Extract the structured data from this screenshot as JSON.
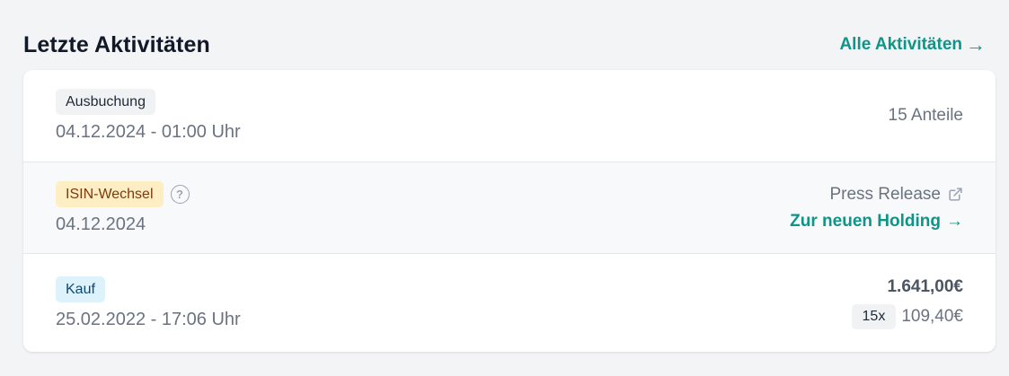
{
  "header": {
    "title": "Letzte Aktivitäten",
    "all_link_label": "Alle Aktivitäten",
    "all_link_arrow": "→"
  },
  "activities": [
    {
      "badge": "Ausbuchung",
      "badge_color": "#f1f2f4",
      "date": "04.12.2024 - 01:00 Uhr",
      "shares": "15 Anteile"
    },
    {
      "badge": "ISIN-Wechsel",
      "badge_color": "#fdefc3",
      "help_icon": "question-circle-icon",
      "date": "04.12.2024",
      "press_label": "Press Release",
      "press_icon": "external-link-icon",
      "holding_link_label": "Zur neuen Holding",
      "holding_link_arrow": "→"
    },
    {
      "badge": "Kauf",
      "badge_color": "#def2fc",
      "date": "25.02.2022 - 17:06 Uhr",
      "amount": "1.641,00€",
      "quantity": "15x",
      "unit_price": "109,40€"
    }
  ],
  "colors": {
    "accent": "#0f9488",
    "background": "#f3f4f6",
    "card": "#ffffff",
    "muted_text": "#6b7280"
  }
}
